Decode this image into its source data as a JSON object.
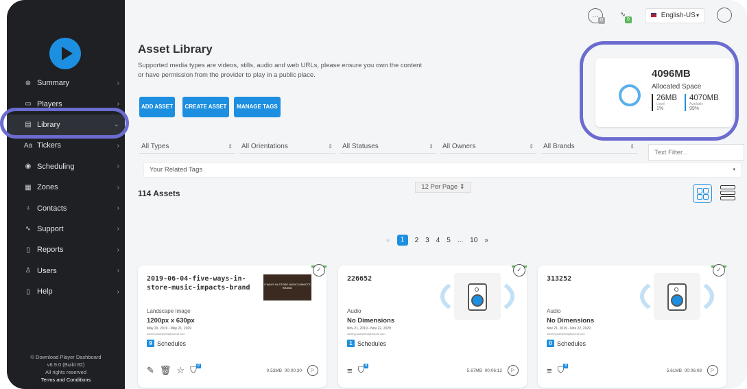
{
  "sidebar": {
    "items": [
      {
        "label": "Summary",
        "icon": "⊛"
      },
      {
        "label": "Players",
        "icon": "▭"
      },
      {
        "label": "Library",
        "icon": "▤"
      },
      {
        "label": "Tickers",
        "icon": "Aa"
      },
      {
        "label": "Scheduling",
        "icon": "◉"
      },
      {
        "label": "Zones",
        "icon": "▦"
      },
      {
        "label": "Contacts",
        "icon": "♁"
      },
      {
        "label": "Support",
        "icon": "∿"
      },
      {
        "label": "Reports",
        "icon": "▯"
      },
      {
        "label": "Users",
        "icon": "♙"
      },
      {
        "label": "Help",
        "icon": "▯"
      }
    ],
    "footer": {
      "download": "© Download Player Dashboard",
      "version": "v6.9.0 (Build 82)",
      "rights": "All rights reserved",
      "terms": "Terms and Conditions"
    }
  },
  "topbar": {
    "chat_badge": "0",
    "activity_badge": "0",
    "language": "English-US"
  },
  "header": {
    "title": "Asset Library",
    "description": "Supported media types are videos, stills, audio and web URLs, please ensure you own the content or have permission from the provider to play in a public place.",
    "buttons": [
      "ADD ASSET",
      "CREATE ASSET",
      "MANAGE TAGS"
    ]
  },
  "storage": {
    "total": "4096MB",
    "label": "Allocated Space",
    "used_value": "26MB",
    "used_label": "Used",
    "used_pct": "1%",
    "available_value": "4070MB",
    "available_label": "Available",
    "available_pct": "99%"
  },
  "filters": {
    "types": "All Types",
    "orientations": "All Orientations",
    "statuses": "All Statuses",
    "owners": "All Owners",
    "brands": "All Brands",
    "text_placeholder": "Text Filter...",
    "tags": "Your Related Tags"
  },
  "assets_count": "114 Assets",
  "per_page": "12 Per Page",
  "pagination": {
    "prev": "«",
    "pages": [
      "1",
      "2",
      "3",
      "4",
      "5",
      "...",
      "10"
    ],
    "next": "»"
  },
  "cards": [
    {
      "title": "2019-06-04-five-ways-in-store-music-impacts-brand",
      "thumb_text": "5 WAYS IN-STORE MUSIC IMPACTS BRAND",
      "type": "Landscape Image",
      "dims": "1200px x 630px",
      "dates": "May 20, 2019 - May 21, 2029",
      "email": "ashley.pauk@imagesound.com",
      "schedules_count": "9",
      "schedules_label": "Schedules",
      "tag_badge": "0",
      "size": "0.53MB",
      "duration": "00:00:30"
    },
    {
      "title": "226652",
      "type": "Audio",
      "dims": "No Dimensions",
      "dates": "Nov 21, 2019 - Nov 22, 2029",
      "email": "ashley.pauk@imagesound.com",
      "schedules_count": "1",
      "schedules_label": "Schedules",
      "tag_badge": "0",
      "size": "5.67MB",
      "duration": "00:06:12"
    },
    {
      "title": "313252",
      "type": "Audio",
      "dims": "No Dimensions",
      "dates": "Nov 21, 2019 - Nov 22, 2029",
      "email": "ashley.pauk@imagesound.com",
      "schedules_count": "0",
      "schedules_label": "Schedules",
      "tag_badge": "0",
      "size": "5.61MB",
      "duration": "00:06:08"
    }
  ],
  "colors": {
    "accent": "#1d8fe0",
    "highlight": "#6b6bd0",
    "sidebar": "#1e2024",
    "status_green": "#5cb85c"
  }
}
